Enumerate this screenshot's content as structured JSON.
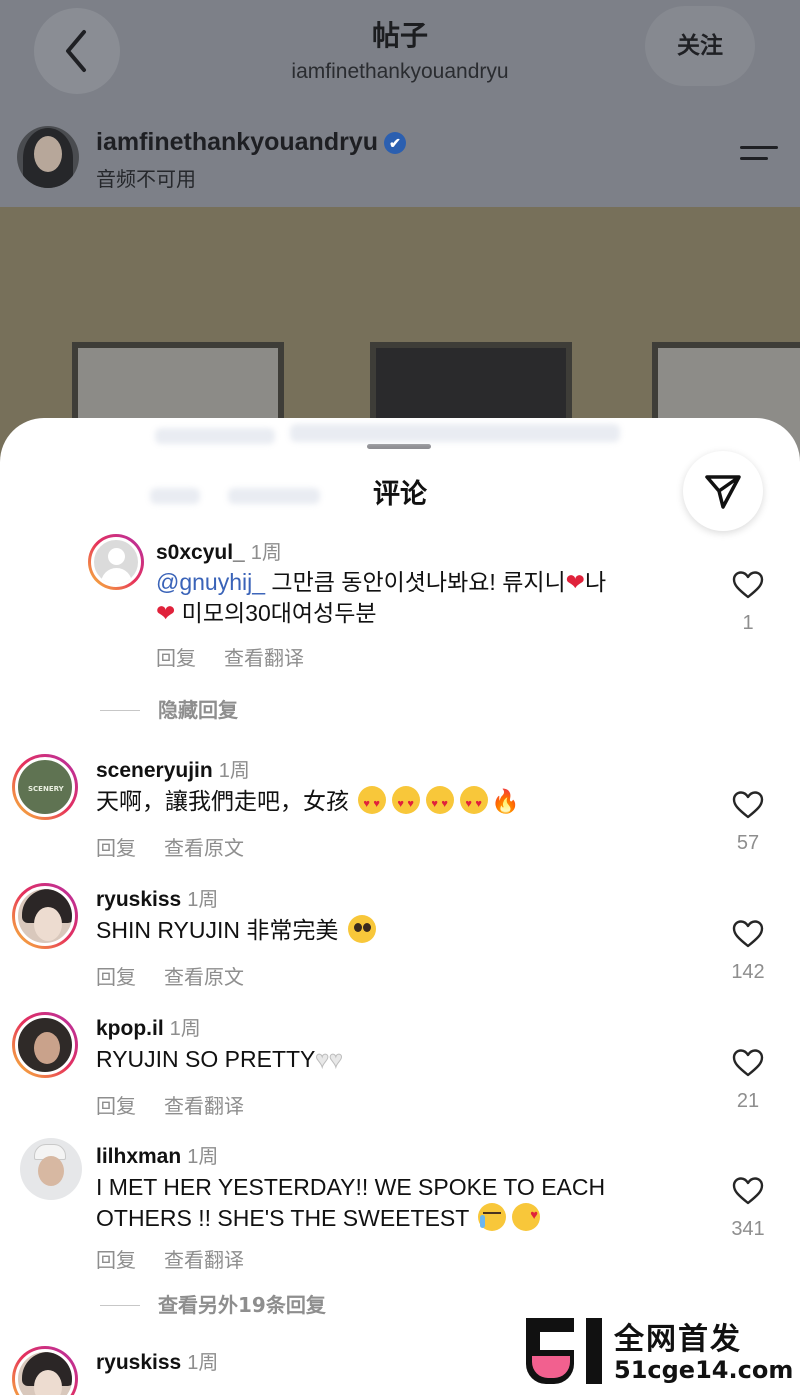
{
  "header": {
    "title": "帖子",
    "subtitle": "iamfinethankyouandryu",
    "follow_label": "关注"
  },
  "author": {
    "name": "iamfinethankyouandryu",
    "sub": "音频不可用",
    "verified_icon": "✔"
  },
  "sheet": {
    "title": "评论"
  },
  "comments": [
    {
      "username": "s0xcyul_",
      "time": "1周",
      "mention": "@gnuyhij_",
      "line1": " 그만큼 동안이셧나봐요! 류지니",
      "line1_end": "나",
      "line2": " 미모의30대여성두분",
      "actions": [
        "回复",
        "查看翻译"
      ],
      "likes": "1"
    },
    {
      "username": "sceneryujin",
      "time": "1周",
      "text": "天啊，讓我們走吧，女孩",
      "actions": [
        "回复",
        "查看原文"
      ],
      "likes": "57"
    },
    {
      "username": "ryuskiss",
      "time": "1周",
      "text": "SHIN RYUJIN 非常完美",
      "actions": [
        "回复",
        "查看原文"
      ],
      "likes": "142"
    },
    {
      "username": "kpop.il",
      "time": "1周",
      "text": "RYUJIN SO PRETTY",
      "actions": [
        "回复",
        "查看翻译"
      ],
      "likes": "21"
    },
    {
      "username": "lilhxman",
      "time": "1周",
      "line1": "I MET HER YESTERDAY!! WE SPOKE TO EACH",
      "line2": "OTHERS !! SHE'S THE SWEETEST",
      "actions": [
        "回复",
        "查看翻译"
      ],
      "likes": "341"
    },
    {
      "username": "ryuskiss",
      "time": "1周"
    }
  ],
  "hide_replies": "隐藏回复",
  "view_more_replies": "查看另外19条回复",
  "watermark": {
    "cn": "全网首发",
    "url": "51cge14.com"
  },
  "emoji": {
    "heart": "❤",
    "fire": "🔥",
    "white_heart": "♥"
  },
  "colors": {
    "accent_link": "#3a63b8",
    "story_ring": [
      "#f9c638",
      "#e6305b",
      "#b22fa8"
    ],
    "verified": "#2b5fb0"
  }
}
